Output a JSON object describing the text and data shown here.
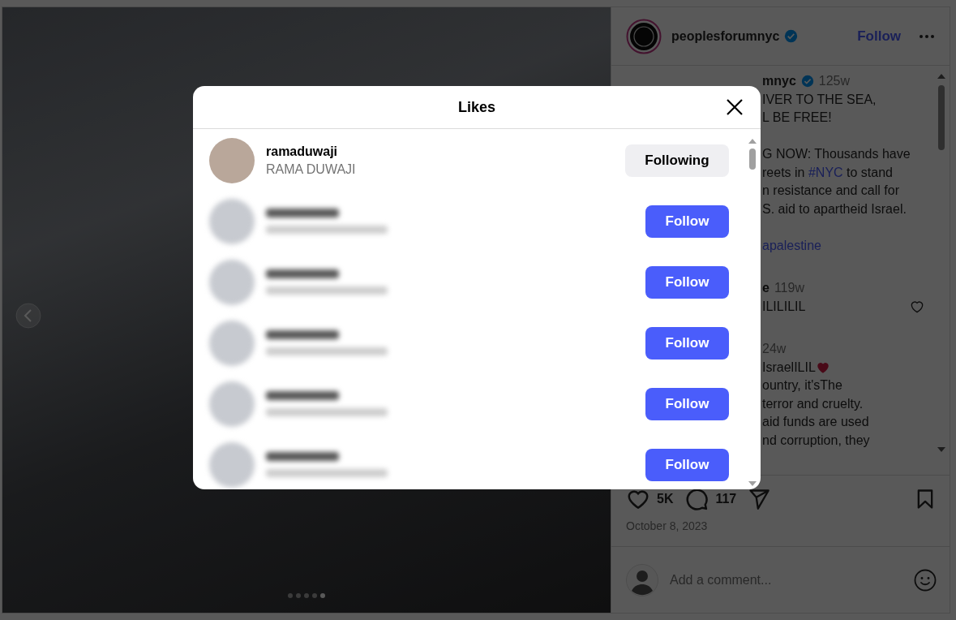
{
  "photo": {
    "slides": [
      {
        "selected": false
      },
      {
        "selected": false
      },
      {
        "selected": false
      },
      {
        "selected": false
      },
      {
        "selected": true
      }
    ]
  },
  "header": {
    "username": "peoplesforumnyc",
    "verified": true,
    "follow": "Follow"
  },
  "comments": [
    {
      "paragraphs": [
        [
          [
            {
              "kind": "name",
              "text": "mnyc"
            },
            {
              "kind": "verified"
            },
            {
              "kind": "time",
              "text": "125w"
            }
          ],
          [
            {
              "kind": "text",
              "text": "IVER TO THE SEA,"
            }
          ],
          [
            {
              "kind": "text",
              "text": "L BE FREE!"
            }
          ]
        ],
        [
          [
            {
              "kind": "text",
              "text": "G NOW: Thousands have"
            }
          ],
          [
            {
              "kind": "text",
              "text": "reets in "
            },
            {
              "kind": "link",
              "text": "#NYC"
            },
            {
              "kind": "text",
              "text": " to stand"
            }
          ],
          [
            {
              "kind": "text",
              "text": "n resistance and call for"
            }
          ],
          [
            {
              "kind": "text",
              "text": "S. aid to apartheid Israel."
            }
          ]
        ],
        [
          [
            {
              "kind": "link",
              "text": "apalestine"
            }
          ]
        ]
      ]
    },
    {
      "paragraphs": [
        [
          [
            {
              "kind": "name",
              "text": "e"
            },
            {
              "kind": "time",
              "text": "119w"
            }
          ],
          [
            {
              "kind": "text",
              "text": "ILILILIL"
            },
            {
              "kind": "like"
            }
          ]
        ]
      ]
    },
    {
      "paragraphs": [
        [
          [
            {
              "kind": "time",
              "text": "24w"
            }
          ],
          [
            {
              "kind": "text",
              "text": "IsraelILIL"
            },
            {
              "kind": "heart-emoji"
            }
          ],
          [
            {
              "kind": "text",
              "text": "ountry, it'sThe"
            }
          ],
          [
            {
              "kind": "text",
              "text": "terror and cruelty."
            }
          ],
          [
            {
              "kind": "text",
              "text": "aid funds are used"
            }
          ],
          [
            {
              "kind": "text",
              "text": "nd corruption, they"
            }
          ]
        ]
      ]
    }
  ],
  "actions": {
    "likes": "5K",
    "comments": "117",
    "date": "October 8, 2023"
  },
  "comment_box": {
    "placeholder": "Add a comment..."
  },
  "likes": {
    "title": "Likes",
    "rows": [
      {
        "username": "ramaduwaji",
        "name": "RAMA DUWAJI",
        "button": "Following",
        "following": true,
        "redacted": false
      },
      {
        "button": "Follow",
        "following": false,
        "redacted": true
      },
      {
        "button": "Follow",
        "following": false,
        "redacted": true
      },
      {
        "button": "Follow",
        "following": false,
        "redacted": true
      },
      {
        "button": "Follow",
        "following": false,
        "redacted": true
      },
      {
        "button": "Follow",
        "following": false,
        "redacted": true
      }
    ]
  }
}
